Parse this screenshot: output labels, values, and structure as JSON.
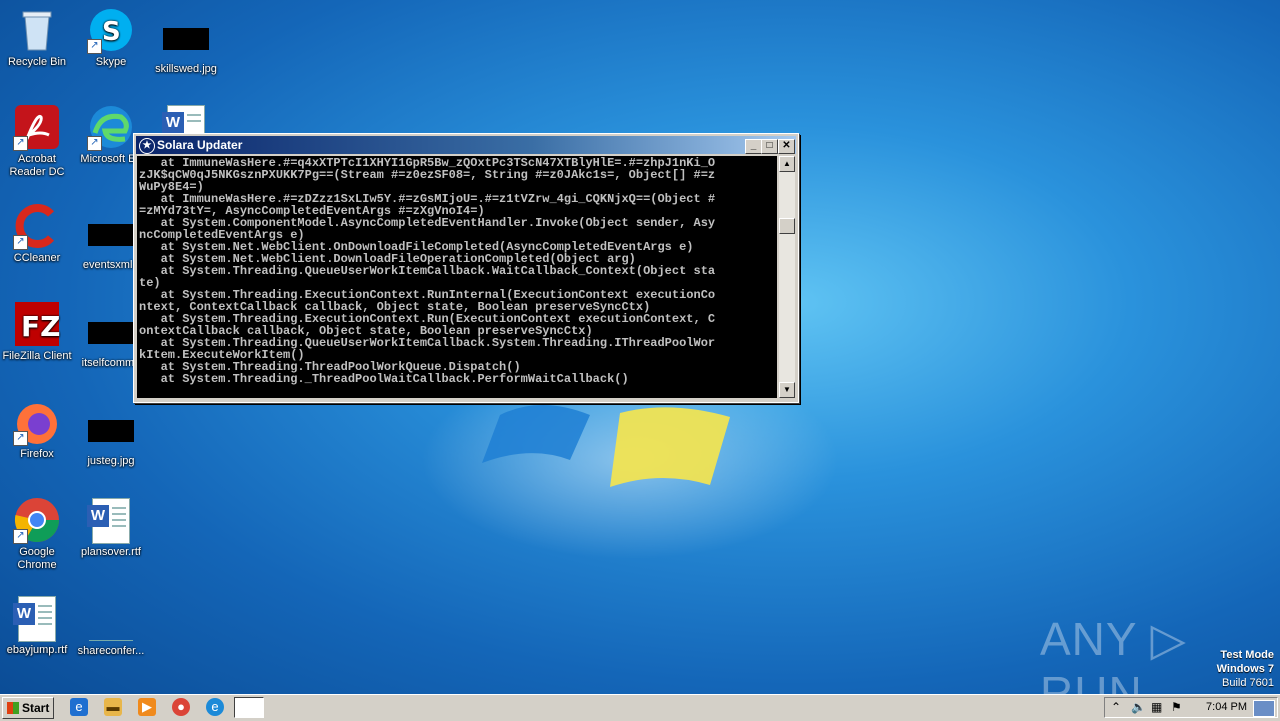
{
  "desktop": {
    "icons": [
      {
        "label": "Recycle Bin",
        "icon": "recycle-bin-icon"
      },
      {
        "label": "Skype",
        "icon": "skype-icon"
      },
      {
        "label": "skillswed.jpg",
        "icon": "image-file-icon"
      },
      {
        "label": "Acrobat Reader DC",
        "icon": "acrobat-icon"
      },
      {
        "label": "Microsoft Ed",
        "icon": "edge-icon"
      },
      {
        "label": "CCleaner",
        "icon": "ccleaner-icon"
      },
      {
        "label": "eventsxml.r",
        "icon": "file-icon"
      },
      {
        "label": "FileZilla Client",
        "icon": "filezilla-icon"
      },
      {
        "label": "itselfcommo",
        "icon": "file-icon"
      },
      {
        "label": "Firefox",
        "icon": "firefox-icon"
      },
      {
        "label": "justeg.jpg",
        "icon": "image-file-icon"
      },
      {
        "label": "Google Chrome",
        "icon": "chrome-icon"
      },
      {
        "label": "plansover.rtf",
        "icon": "word-doc-icon"
      },
      {
        "label": "ebayjump.rtf",
        "icon": "word-doc-icon"
      },
      {
        "label": "shareconfer...",
        "icon": "file-icon"
      }
    ]
  },
  "window": {
    "title": "Solara Updater",
    "minimize": "_",
    "maximize": "□",
    "close": "✕",
    "console_text": "   at ImmuneWasHere.#=q4xXTPTcI1XHYI1GpR5Bw_zQOxtPc3TScN47XTBlyHlE=.#=zhpJ1nKi_O\nzJK$qCW0qJ5NKGsznPXUKK7Pg==(Stream #=z0ezSF08=, String #=z0JAkc1s=, Object[] #=z\nWuPy8E4=)\n   at ImmuneWasHere.#=zDZzz1SxLIw5Y.#=zGsMIjoU=.#=z1tVZrw_4gi_CQKNjxQ==(Object #\n=zMYd73tY=, AsyncCompletedEventArgs #=zXgVnoI4=)\n   at System.ComponentModel.AsyncCompletedEventHandler.Invoke(Object sender, Asy\nncCompletedEventArgs e)\n   at System.Net.WebClient.OnDownloadFileCompleted(AsyncCompletedEventArgs e)\n   at System.Net.WebClient.DownloadFileOperationCompleted(Object arg)\n   at System.Threading.QueueUserWorkItemCallback.WaitCallback_Context(Object sta\nte)\n   at System.Threading.ExecutionContext.RunInternal(ExecutionContext executionCo\nntext, ContextCallback callback, Object state, Boolean preserveSyncCtx)\n   at System.Threading.ExecutionContext.Run(ExecutionContext executionContext, C\nontextCallback callback, Object state, Boolean preserveSyncCtx)\n   at System.Threading.QueueUserWorkItemCallback.System.Threading.IThreadPoolWor\nkItem.ExecuteWorkItem()\n   at System.Threading.ThreadPoolWorkQueue.Dispatch()\n   at System.Threading._ThreadPoolWaitCallback.PerformWaitCallback()"
  },
  "watermark": {
    "brand": "ANY ▷ RUN",
    "mode": "Test Mode",
    "os": "Windows 7",
    "build": "Build 7601"
  },
  "taskbar": {
    "start_label": "Start",
    "clock": "7:04 PM"
  },
  "colors": {
    "desktop_blue": "#1466b8",
    "titlebar_start": "#0a246a",
    "console_bg": "#000000",
    "console_text": "#c0c0c0"
  }
}
